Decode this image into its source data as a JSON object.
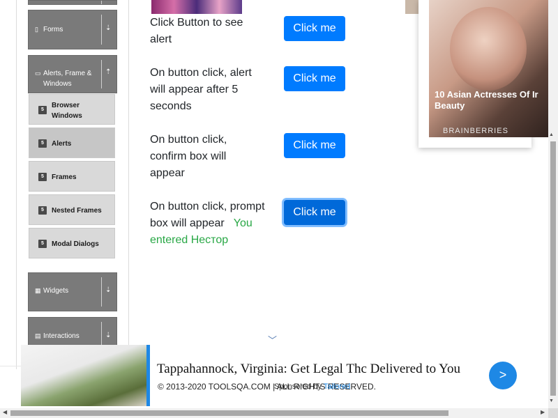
{
  "sidebar": {
    "groups": [
      {
        "label": "Forms",
        "icon": "document-icon"
      },
      {
        "label": "Alerts, Frame & Windows",
        "icon": "window-icon"
      },
      {
        "label": "Widgets",
        "icon": "grid-icon"
      },
      {
        "label": "Interactions",
        "icon": "list-icon"
      }
    ],
    "items": [
      {
        "label": "Browser Windows",
        "badge": "5"
      },
      {
        "label": "Alerts",
        "badge": "5"
      },
      {
        "label": "Frames",
        "badge": "5"
      },
      {
        "label": "Nested Frames",
        "badge": "5"
      },
      {
        "label": "Modal Dialogs",
        "badge": "5"
      }
    ],
    "expand_glyph": "⇣",
    "collapse_glyph": "⇡"
  },
  "main": {
    "rows": [
      {
        "text": "Click Button to see alert",
        "button": "Click me"
      },
      {
        "text": "On button click, alert will appear after 5 seconds",
        "button": "Click me"
      },
      {
        "text": "On button click, confirm box will appear",
        "button": "Click me"
      },
      {
        "text": "On button click, prompt box will appear",
        "button": "Click me",
        "result": "You entered Нестор"
      }
    ]
  },
  "ad": {
    "title": "10 Asian Actresses Of Ir Beauty",
    "brand": "BRAINBERRIES"
  },
  "banner": {
    "title": "Tappahannock, Virginia: Get Legal Thc Delivered to You",
    "sponsor_prefix": "Sponsored by",
    "sponsor_name": "Tailored",
    "go": ">"
  },
  "footer": {
    "text": "© 2013-2020 TOOLSQA.COM | ALL RIGHTS RESERVED."
  },
  "colors": {
    "primary_button": "#007bff",
    "result_text": "#28a745",
    "sidebar_group": "#7a7a7a",
    "sidebar_item": "#d9d9d9"
  }
}
